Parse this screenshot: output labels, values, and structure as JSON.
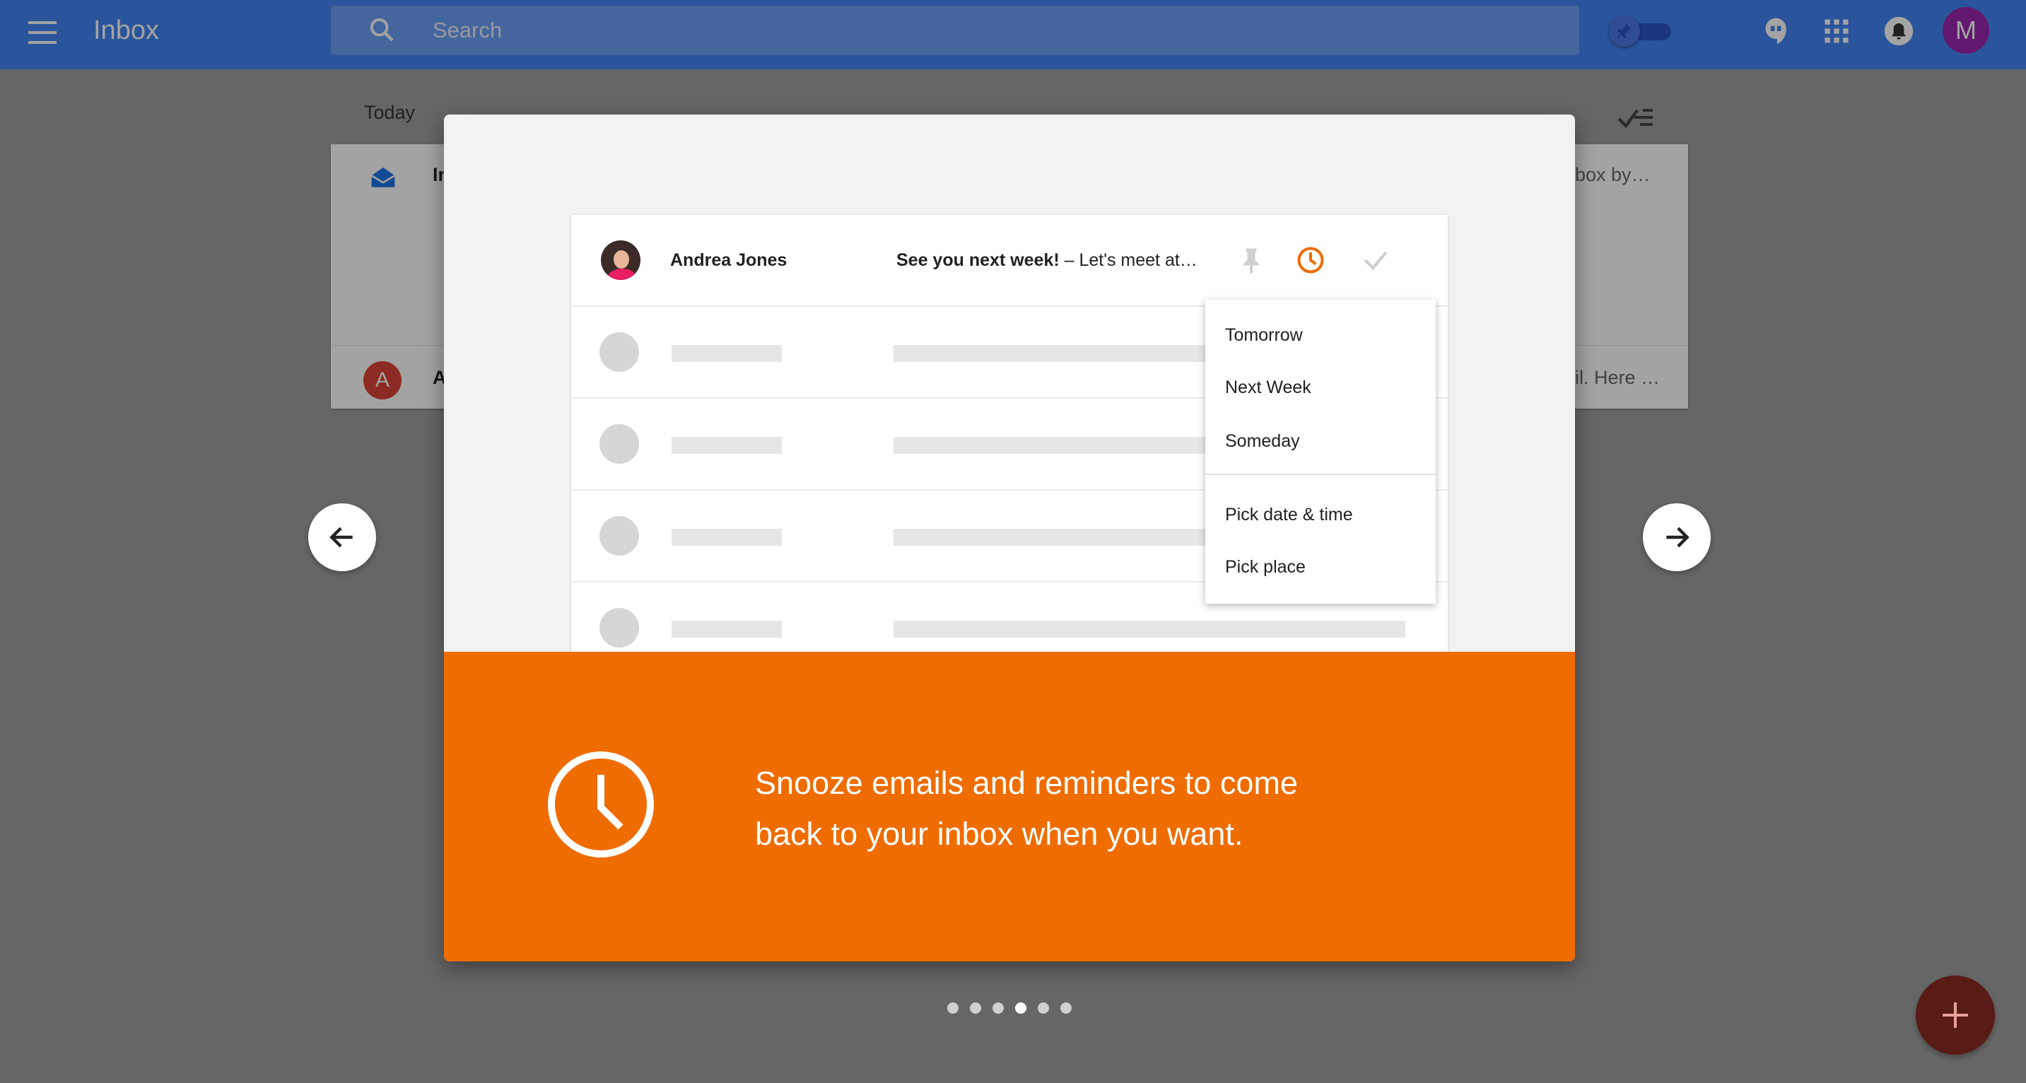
{
  "topbar": {
    "title": "Inbox",
    "search_placeholder": "Search",
    "account_initial": "M",
    "icons": [
      "menu-icon",
      "search-icon",
      "pin-toggle",
      "hangouts-icon",
      "apps-grid-icon",
      "notifications-icon",
      "account-avatar"
    ]
  },
  "background": {
    "section_today": "Today",
    "rows": [
      {
        "sender_fragment": "In",
        "snippet_fragment": "box by…",
        "icon": "bundle-icon"
      },
      {
        "sender_fragment": "A",
        "avatar_letter": "A",
        "snippet_fragment": "il. Here …"
      }
    ]
  },
  "dialog": {
    "sample_email": {
      "sender": "Andrea Jones",
      "subject": "See you next week!",
      "snippet": " – Let's meet at…"
    },
    "snooze_menu": {
      "items": [
        "Tomorrow",
        "Next Week",
        "Someday"
      ],
      "more_items": [
        "Pick date & time",
        "Pick place"
      ]
    },
    "banner": {
      "line1": "Snooze emails and reminders to come",
      "line2": "back to your inbox when you want."
    },
    "pagination": {
      "total": 6,
      "active_index": 3
    }
  },
  "colors": {
    "topbar": "#4285f4",
    "banner": "#ef6c00",
    "snooze_icon": "#ef6c00",
    "fab": "#db4437"
  }
}
